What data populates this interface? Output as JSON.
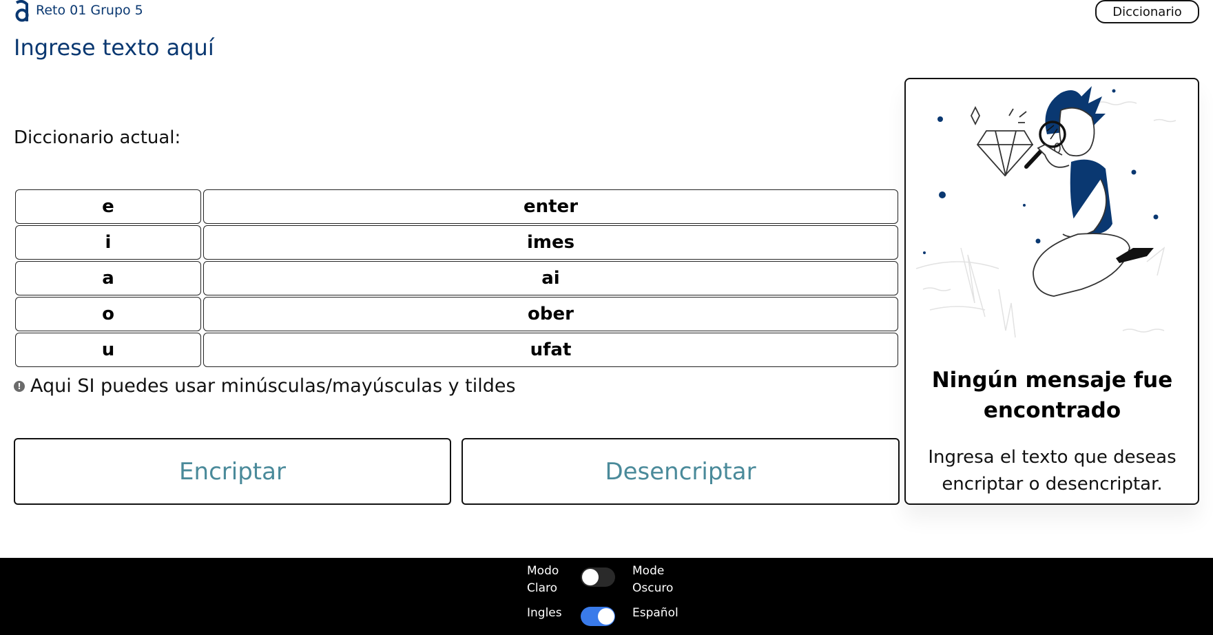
{
  "header": {
    "app_title": "Reto 01 Grupo 5",
    "dictionary_button": "Diccionario"
  },
  "input": {
    "placeholder": "Ingrese texto aquí"
  },
  "dictionary": {
    "label": "Diccionario actual:",
    "rows": [
      {
        "key": "e",
        "value": "enter"
      },
      {
        "key": "i",
        "value": "imes"
      },
      {
        "key": "a",
        "value": "ai"
      },
      {
        "key": "o",
        "value": "ober"
      },
      {
        "key": "u",
        "value": "ufat"
      }
    ]
  },
  "hint": {
    "icon": "info-icon",
    "text": "Aqui SI puedes usar minúsculas/mayúsculas y tildes"
  },
  "actions": {
    "encrypt_label": "Encriptar",
    "decrypt_label": "Desencriptar"
  },
  "output": {
    "title": "Ningún mensaje fue encontrado",
    "text": "Ingresa el texto que deseas encriptar o desencriptar."
  },
  "footer": {
    "light_mode_label": "Modo Claro",
    "dark_mode_label": "Mode Oscuro",
    "dark_mode_enabled": false,
    "english_label": "Ingles",
    "spanish_label": "Español",
    "spanish_enabled": true
  },
  "colors": {
    "brand": "#0a3871",
    "button_text": "#4a8a9a",
    "toggle_on": "#3a7bea"
  }
}
